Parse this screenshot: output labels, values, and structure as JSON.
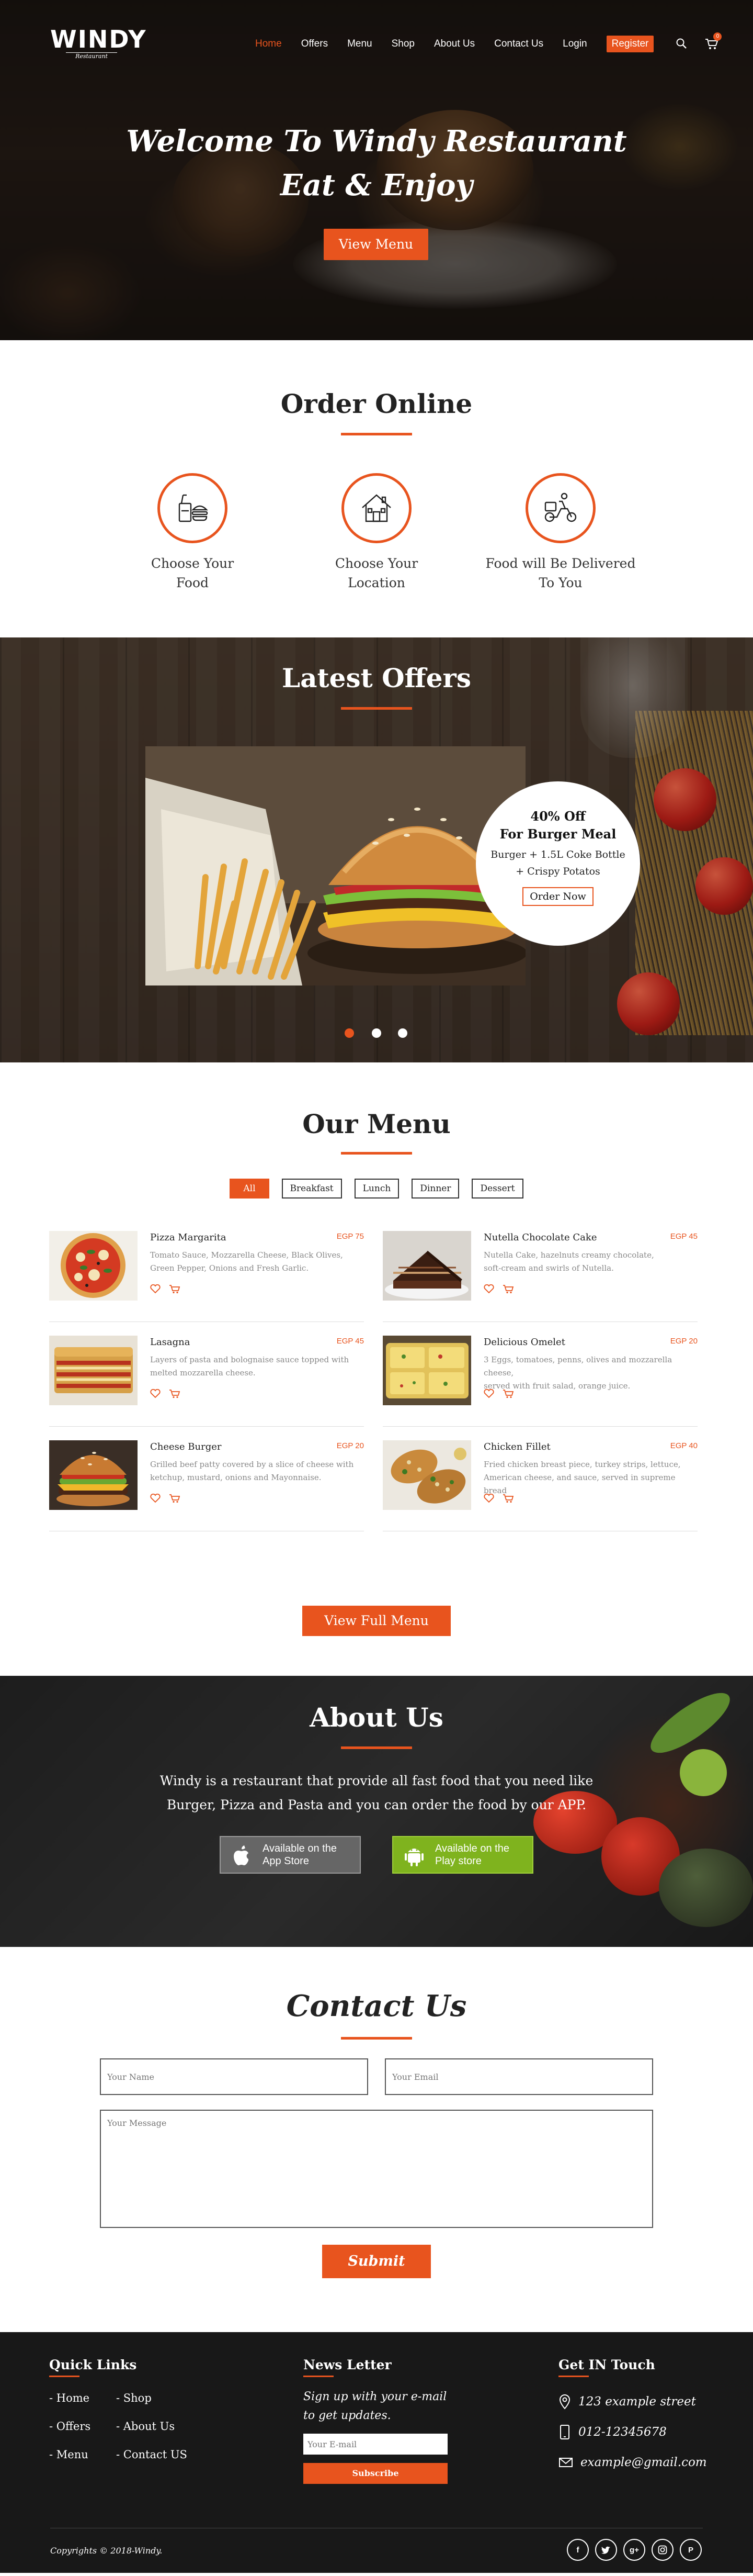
{
  "nav": {
    "logo": "WINDY",
    "logo_sub": "Restaurant",
    "links": [
      "Home",
      "Offers",
      "Menu",
      "Shop",
      "About Us",
      "Contact Us",
      "Login"
    ],
    "register": "Register",
    "cart_count": "0"
  },
  "hero": {
    "line1": "Welcome To Windy Restaurant",
    "line2": "Eat & Enjoy",
    "button": "View Menu"
  },
  "order": {
    "title": "Order Online",
    "items": [
      {
        "line1": "Choose Your",
        "line2": "Food",
        "icon": "fast-food-icon"
      },
      {
        "line1": "Choose Your",
        "line2": "Location",
        "icon": "house-icon"
      },
      {
        "line1": "Food will Be Delivered",
        "line2": "To You",
        "icon": "delivery-scooter-icon"
      }
    ]
  },
  "offers": {
    "title": "Latest Offers",
    "card_title1": "40% Off",
    "card_title2": "For Burger Meal",
    "card_desc1": "Burger + 1.5L Coke Bottle",
    "card_desc2": "+ Crispy Potatos",
    "card_button": "Order Now"
  },
  "menu": {
    "title": "Our Menu",
    "tabs": [
      "All",
      "Breakfast",
      "Lunch",
      "Dinner",
      "Dessert"
    ],
    "dishes": [
      {
        "name": "Pizza Margarita",
        "price": "EGP 75",
        "desc1": "Tomato Sauce, Mozzarella Cheese, Black Olives,",
        "desc2": "Green Pepper, Onions and Fresh Garlic."
      },
      {
        "name": "Nutella Chocolate Cake",
        "price": "EGP 45",
        "desc1": "Nutella Cake, hazelnuts creamy chocolate,",
        "desc2": "soft-cream and swirls of Nutella."
      },
      {
        "name": "Lasagna",
        "price": "EGP 45",
        "desc1": "Layers of pasta and bolognaise sauce topped with",
        "desc2": "melted mozzarella cheese."
      },
      {
        "name": "Delicious Omelet",
        "price": "EGP 20",
        "desc1": "3 Eggs, tomatoes, penns, olives and mozzarella cheese,",
        "desc2": "served with fruit salad, orange juice."
      },
      {
        "name": "Cheese Burger",
        "price": "EGP 20",
        "desc1": "Grilled beef patty covered by a slice of cheese with",
        "desc2": "ketchup, mustard, onions and Mayonnaise."
      },
      {
        "name": "Chicken Fillet",
        "price": "EGP 40",
        "desc1": "Fried chicken breast piece, turkey strips, lettuce,",
        "desc2": "American cheese, and sauce, served in supreme bread"
      }
    ],
    "full_button": "View Full Menu"
  },
  "about": {
    "title": "About Us",
    "line1": "Windy is a restaurant that provide all fast food that you need like",
    "line2": "Burger, Pizza and Pasta and you can order the food by our APP.",
    "appstore1": "Available on the",
    "appstore2": "App Store",
    "playstore1": "Available on the",
    "playstore2": "Play store",
    "appstore_color": "#666666",
    "playstore_color": "#7fb31e"
  },
  "contact": {
    "title": "Contact Us",
    "name_placeholder": "Your Name",
    "email_placeholder": "Your Email",
    "message_placeholder": "Your Message",
    "submit": "Submit"
  },
  "footer": {
    "quick_title": "Quick Links",
    "quick_links": [
      "- Home",
      "- Shop",
      "- Offers",
      "- About Us",
      "- Menu",
      "- Contact US"
    ],
    "news_title": "News Letter",
    "news_line1": "Sign up with your e-mail",
    "news_line2": "to get updates.",
    "news_placeholder": "Your E-mail",
    "news_button": "Subscribe",
    "touch_title": "Get IN Touch",
    "address": "123 example street",
    "phone": "012-12345678",
    "email": "example@gmail.com",
    "copyright": "Copyrights © 2018-Windy.",
    "socials": [
      "facebook-icon",
      "twitter-icon",
      "google-plus-icon",
      "instagram-icon",
      "pinterest-icon"
    ]
  },
  "colors": {
    "accent": "#e8541e",
    "dark": "#181818"
  }
}
